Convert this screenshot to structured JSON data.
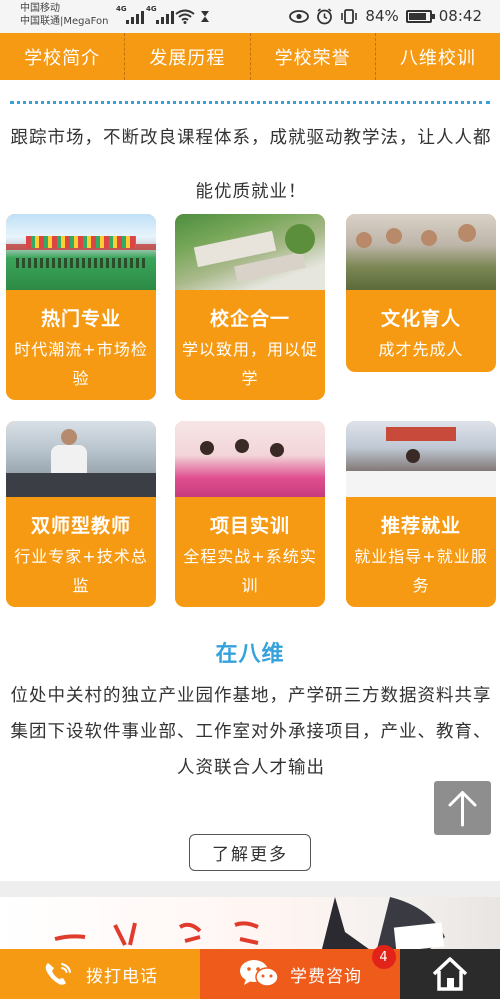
{
  "status_bar": {
    "carrier1": "中国移动",
    "carrier2": "中国联通|MegaFon",
    "network1": "4G",
    "network2": "4G",
    "battery": "84%",
    "battery_level": 0.84,
    "time": "08:42",
    "icons": [
      "eye-icon",
      "alarm-icon",
      "vibrate-icon",
      "wifi-icon",
      "hourglass-icon"
    ]
  },
  "nav": {
    "items": [
      "学校简介",
      "发展历程",
      "学校荣誉",
      "八维校训"
    ]
  },
  "intro": {
    "text": "跟踪市场，不断改良课程体系，成就驱动教学法，让人人都能优质就业！"
  },
  "cards": [
    {
      "title": "热门专业",
      "desc": "时代潮流+市场检验"
    },
    {
      "title": "校企合一",
      "desc": "学以致用，用以促学"
    },
    {
      "title": "文化育人",
      "desc": "成才先成人"
    },
    {
      "title": "双师型教师",
      "desc": "行业专家+技术总监"
    },
    {
      "title": "项目实训",
      "desc": "全程实战+系统实训"
    },
    {
      "title": "推荐就业",
      "desc": "就业指导+就业服务"
    }
  ],
  "zai": {
    "title": "在八维",
    "line1": "位处中关村的独立产业园作基地，产学研三方数据资料共享",
    "line2": "集团下设软件事业部、工作室对外承接项目，产业、教育、人资联合人才输出",
    "more": "了解更多"
  },
  "bottom_bar": {
    "call": "拨打电话",
    "consult": "学费咨询",
    "badge": "4"
  },
  "colors": {
    "orange": "#f79a13",
    "deep_orange": "#ee5b1a",
    "blue": "#35a2dc",
    "dark": "#2b2b2b"
  }
}
